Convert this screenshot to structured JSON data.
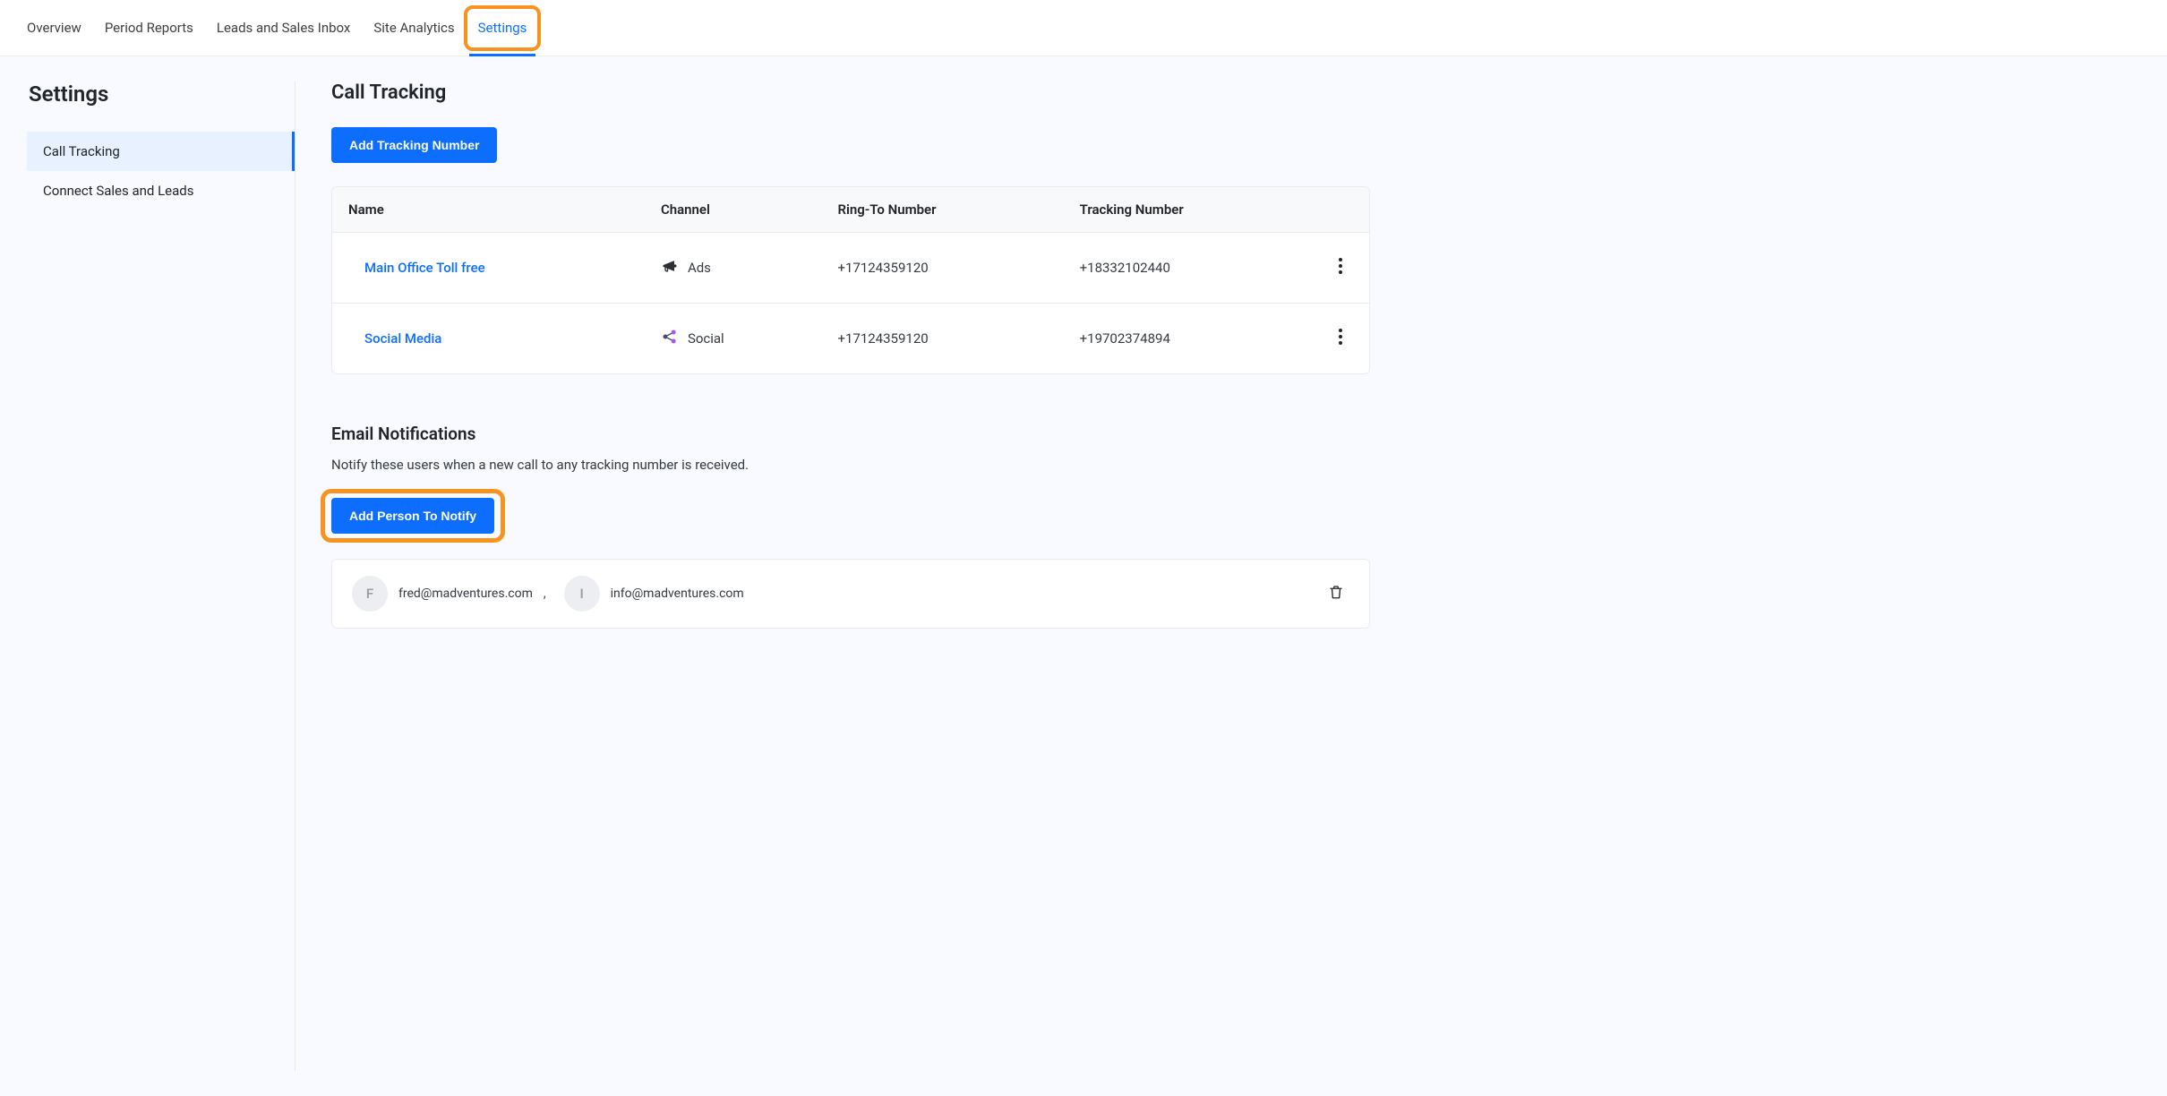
{
  "nav": {
    "items": [
      {
        "label": "Overview",
        "active": false
      },
      {
        "label": "Period Reports",
        "active": false
      },
      {
        "label": "Leads and Sales Inbox",
        "active": false
      },
      {
        "label": "Site Analytics",
        "active": false
      },
      {
        "label": "Settings",
        "active": true
      }
    ]
  },
  "sidebar": {
    "title": "Settings",
    "items": [
      {
        "label": "Call Tracking",
        "active": true
      },
      {
        "label": "Connect Sales and Leads",
        "active": false
      }
    ]
  },
  "callTracking": {
    "title": "Call Tracking",
    "addButton": "Add Tracking Number",
    "columns": {
      "name": "Name",
      "channel": "Channel",
      "ringTo": "Ring-To Number",
      "tracking": "Tracking Number"
    },
    "rows": [
      {
        "name": "Main Office Toll free",
        "channelIcon": "ads",
        "channel": "Ads",
        "ringTo": "+17124359120",
        "tracking": "+18332102440"
      },
      {
        "name": "Social Media",
        "channelIcon": "social",
        "channel": "Social",
        "ringTo": "+17124359120",
        "tracking": "+19702374894"
      }
    ]
  },
  "emailNotifications": {
    "title": "Email Notifications",
    "description": "Notify these users when a new call to any tracking number is received.",
    "addButton": "Add Person To Notify",
    "people": [
      {
        "initial": "F",
        "email": "fred@madventures.com"
      },
      {
        "initial": "I",
        "email": "info@madventures.com"
      }
    ]
  }
}
